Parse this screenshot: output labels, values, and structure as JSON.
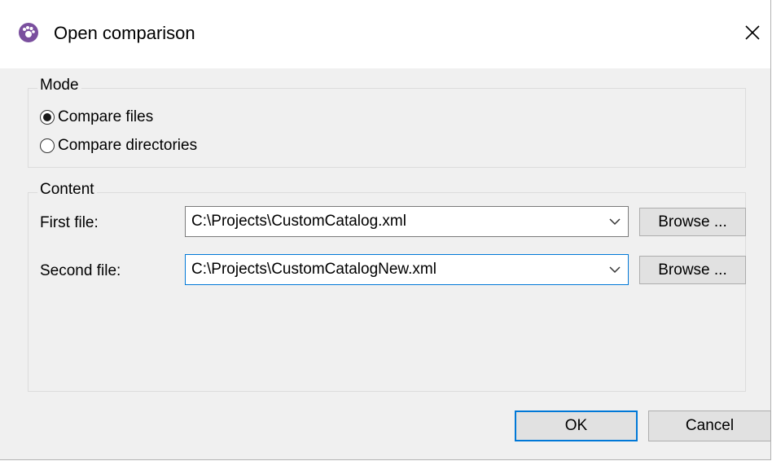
{
  "window": {
    "title": "Open comparison",
    "app_icon": "altova-diffdog-icon",
    "close_icon": "close-icon"
  },
  "mode": {
    "label": "Mode",
    "options": [
      {
        "label": "Compare files",
        "checked": true
      },
      {
        "label": "Compare directories",
        "checked": false
      }
    ]
  },
  "content": {
    "label": "Content",
    "first_file": {
      "label": "First file:",
      "value": "C:\\Projects\\CustomCatalog.xml",
      "browse_label": "Browse ..."
    },
    "second_file": {
      "label": "Second file:",
      "value": "C:\\Projects\\CustomCatalogNew.xml",
      "browse_label": "Browse ..."
    }
  },
  "footer": {
    "ok_label": "OK",
    "cancel_label": "Cancel"
  },
  "colors": {
    "accent": "#0078d7",
    "dialog_bg": "#f0f0f0",
    "app_icon_color": "#7a4f9e"
  }
}
